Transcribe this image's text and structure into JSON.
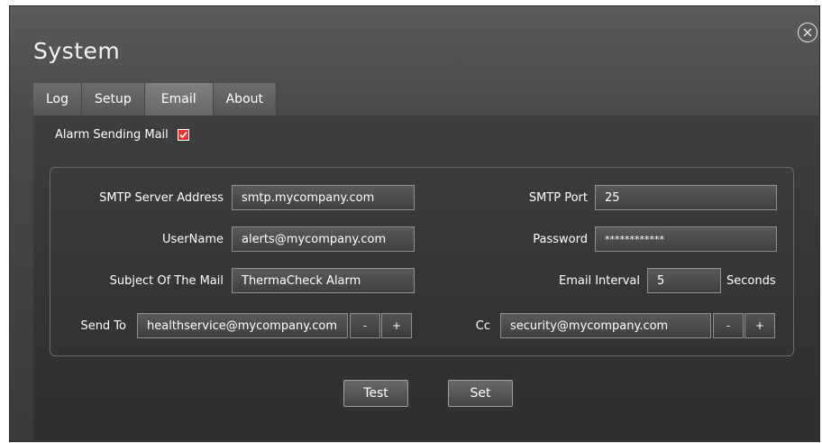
{
  "window": {
    "title": "System"
  },
  "tabs": [
    {
      "label": "Log"
    },
    {
      "label": "Setup"
    },
    {
      "label": "Email"
    },
    {
      "label": "About"
    }
  ],
  "active_tab": "Email",
  "alarm_sending_mail": {
    "label": "Alarm Sending Mail",
    "checked": true,
    "check_color": "#e3342f"
  },
  "smtp_server": {
    "label": "SMTP Server Address",
    "value": "smtp.mycompany.com"
  },
  "smtp_port": {
    "label": "SMTP Port",
    "value": "25"
  },
  "username": {
    "label": "UserName",
    "value": "alerts@mycompany.com"
  },
  "password": {
    "label": "Password",
    "value": "************"
  },
  "subject": {
    "label": "Subject Of The Mail",
    "value": "ThermaCheck Alarm"
  },
  "email_interval": {
    "label": "Email Interval",
    "value": "5",
    "unit": "Seconds"
  },
  "send_to": {
    "label": "Send To",
    "value": "healthservice@mycompany.com",
    "minus": "-",
    "plus": "+"
  },
  "cc": {
    "label": "Cc",
    "value": "security@mycompany.com",
    "minus": "-",
    "plus": "+"
  },
  "buttons": {
    "test": "Test",
    "set": "Set"
  }
}
